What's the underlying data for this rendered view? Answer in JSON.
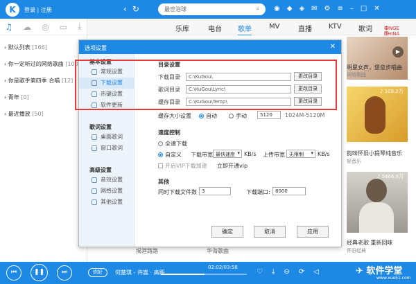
{
  "app": {
    "logo": "K",
    "login": "登录 | 注册",
    "search_placeholder": "最世浴球",
    "brand_line1": "中国最新",
    "brand_line2": "SINGE CHINA"
  },
  "main_tabs": [
    "乐库",
    "电台",
    "歌单",
    "MV",
    "直播",
    "KTV",
    "歌词"
  ],
  "sidebar": {
    "playlists": [
      {
        "name": "默认列表",
        "count": "[166]"
      },
      {
        "name": "你一定听过的网络歌曲",
        "count": "[100]"
      },
      {
        "name": "你是歌手第四季 合唱",
        "count": "[12]"
      },
      {
        "name": "青年",
        "count": "[0]"
      },
      {
        "name": "最近播放",
        "count": "[50]"
      }
    ]
  },
  "cards": [
    {
      "title": "明星女声，堡垒步唱曲",
      "sub": "网络歌曲"
    },
    {
      "count": "109.2万",
      "title": "韵味怀旧小提琴纯音乐",
      "sub": "轻音乐"
    },
    {
      "count": "5866.8万",
      "title": "经典老歌 重新回味",
      "sub": "怀旧经典"
    }
  ],
  "dialog": {
    "title": "选项设置",
    "close": "✕",
    "groups": [
      {
        "title": "基本设置",
        "items": [
          "常规设置",
          "下载设置",
          "热键设置",
          "软件更新"
        ]
      },
      {
        "title": "歌词设置",
        "items": [
          "桌面歌词",
          "窗口歌词"
        ]
      },
      {
        "title": "高级设置",
        "items": [
          "音效设置",
          "网络设置",
          "其他设置"
        ]
      }
    ],
    "selected_item": "下载设置",
    "dir_header": "目录设置",
    "dirs": [
      {
        "label": "下载目录",
        "path": "C:\\KuGou\\",
        "btn": "更改目录"
      },
      {
        "label": "歌词目录",
        "path": "C:\\KuGou\\Lyric\\",
        "btn": "更改目录"
      },
      {
        "label": "缓存目录",
        "path": "C:\\KuGou\\Temp\\",
        "btn": "更改目录"
      }
    ],
    "cache_label": "缓存大小设置",
    "cache_auto": "自动",
    "cache_manual": "手动",
    "cache_value": "5120",
    "cache_hint": "1024M-5120M",
    "speed_header": "速度控制",
    "speed_full": "全速下载",
    "speed_custom": "自定义",
    "dl_bw_label": "下载带宽",
    "dl_bw_value": "最快速度",
    "dl_unit": "KB/s",
    "ul_bw_label": "上传带宽",
    "ul_bw_value": "无限制",
    "ul_unit": "KB/s",
    "vip_label": "开启VIP下载加速",
    "vip_link": "立即开通vip",
    "other_header": "其他",
    "concurrent_label": "同时下载文件数",
    "concurrent_value": "3",
    "port_label": "下载端口:",
    "port_value": "8000",
    "ok": "确定",
    "cancel": "取消",
    "apply": "应用"
  },
  "strip_text": [
    "揭港路路",
    "华海歌曲"
  ],
  "player": {
    "track_pill": "你好",
    "track": "何楚琪 - 许嵩 · 高殿",
    "time": "02:02/03:58",
    "progress": 0.51
  },
  "watermark": {
    "main": "软件学堂",
    "sub": "www.xue51.com"
  },
  "colors": {
    "accent": "#1e88e5",
    "highlight_frame": "#e53935"
  }
}
